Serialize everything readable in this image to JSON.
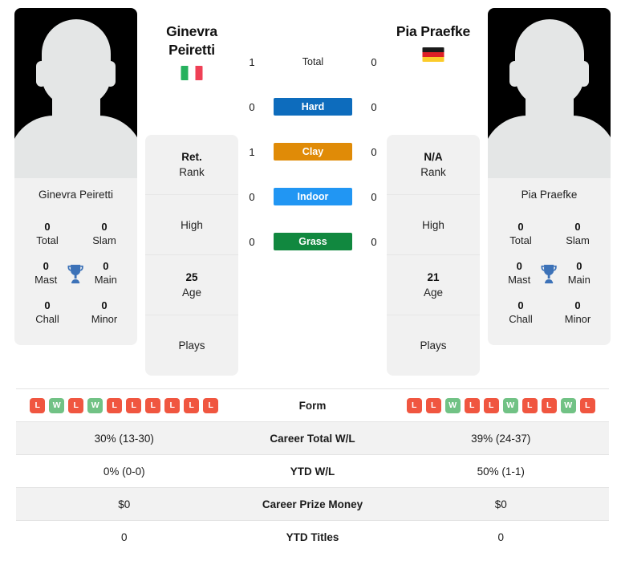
{
  "players": {
    "left": {
      "first_name": "Ginevra",
      "last_name": "Peiretti",
      "full_name": "Ginevra Peiretti",
      "country": "Italy",
      "flag_icon": "flag-italy-icon",
      "avatar_icon": "player-avatar-placeholder-icon",
      "titles": {
        "total_value": "0",
        "total_label": "Total",
        "slam_value": "0",
        "slam_label": "Slam",
        "mast_value": "0",
        "mast_label": "Mast",
        "main_value": "0",
        "main_label": "Main",
        "chall_value": "0",
        "chall_label": "Chall",
        "minor_value": "0",
        "minor_label": "Minor",
        "trophy_icon": "trophy-icon"
      },
      "info": {
        "rank_value": "Ret.",
        "rank_label": "Rank",
        "high_value": "",
        "high_label": "High",
        "age_value": "25",
        "age_label": "Age",
        "plays_value": "",
        "plays_label": "Plays"
      },
      "surface_wins": {
        "total": "1",
        "hard": "0",
        "clay": "1",
        "indoor": "0",
        "grass": "0"
      },
      "form": [
        "L",
        "W",
        "L",
        "W",
        "L",
        "L",
        "L",
        "L",
        "L",
        "L"
      ],
      "career_total_wl": "30% (13-30)",
      "ytd_wl": "0% (0-0)",
      "career_prize_money": "$0",
      "ytd_titles": "0"
    },
    "right": {
      "first_name": "Pia",
      "last_name": "Praefke",
      "full_name": "Pia Praefke",
      "country": "Germany",
      "flag_icon": "flag-germany-icon",
      "avatar_icon": "player-avatar-placeholder-icon",
      "titles": {
        "total_value": "0",
        "total_label": "Total",
        "slam_value": "0",
        "slam_label": "Slam",
        "mast_value": "0",
        "mast_label": "Mast",
        "main_value": "0",
        "main_label": "Main",
        "chall_value": "0",
        "chall_label": "Chall",
        "minor_value": "0",
        "minor_label": "Minor",
        "trophy_icon": "trophy-icon"
      },
      "info": {
        "rank_value": "N/A",
        "rank_label": "Rank",
        "high_value": "",
        "high_label": "High",
        "age_value": "21",
        "age_label": "Age",
        "plays_value": "",
        "plays_label": "Plays"
      },
      "surface_wins": {
        "total": "0",
        "hard": "0",
        "clay": "0",
        "indoor": "0",
        "grass": "0"
      },
      "form": [
        "L",
        "L",
        "W",
        "L",
        "L",
        "W",
        "L",
        "L",
        "W",
        "L"
      ],
      "career_total_wl": "39% (24-37)",
      "ytd_wl": "50% (1-1)",
      "career_prize_money": "$0",
      "ytd_titles": "0"
    }
  },
  "surfaces": [
    {
      "key": "total",
      "label": "Total",
      "color": "transparent"
    },
    {
      "key": "hard",
      "label": "Hard",
      "color": "#0d6cbd"
    },
    {
      "key": "clay",
      "label": "Clay",
      "color": "#e08b07"
    },
    {
      "key": "indoor",
      "label": "Indoor",
      "color": "#2196f3"
    },
    {
      "key": "grass",
      "label": "Grass",
      "color": "#11883f"
    }
  ],
  "comparison_rows": [
    {
      "label": "Form"
    },
    {
      "label": "Career Total W/L"
    },
    {
      "label": "YTD W/L"
    },
    {
      "label": "Career Prize Money"
    },
    {
      "label": "YTD Titles"
    }
  ],
  "colors": {
    "win_badge": "#71c285",
    "loss_badge": "#f05640",
    "card_bg": "#f1f1f1",
    "row_alt_bg": "#f2f2f2"
  }
}
